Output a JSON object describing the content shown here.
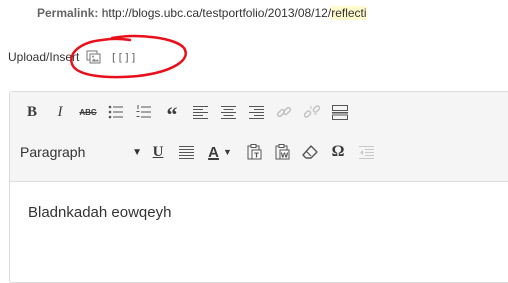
{
  "permalink": {
    "label": "Permalink:",
    "url_prefix": "http://blogs.ubc.ca/testportfolio/2013/08/12/",
    "url_slug": "reflecti"
  },
  "upload": {
    "label": "Upload/Insert",
    "shortcode_glyph": "[[]]"
  },
  "toolbar": {
    "row1": [
      "bold",
      "italic",
      "strikethrough",
      "bullet-list",
      "numbered-list",
      "blockquote",
      "align-left",
      "align-center",
      "align-right",
      "link",
      "unlink",
      "more"
    ],
    "bold_label": "B",
    "italic_label": "I",
    "strike_label": "ABC",
    "quote_label": "“",
    "format_select": "Paragraph",
    "underline_label": "U",
    "text_color_label": "A",
    "omega_label": "Ω"
  },
  "editor": {
    "content": "Bladnkadah eowqeyh"
  },
  "colors": {
    "annotation": "#e8101a",
    "highlight": "#fffbcc"
  }
}
